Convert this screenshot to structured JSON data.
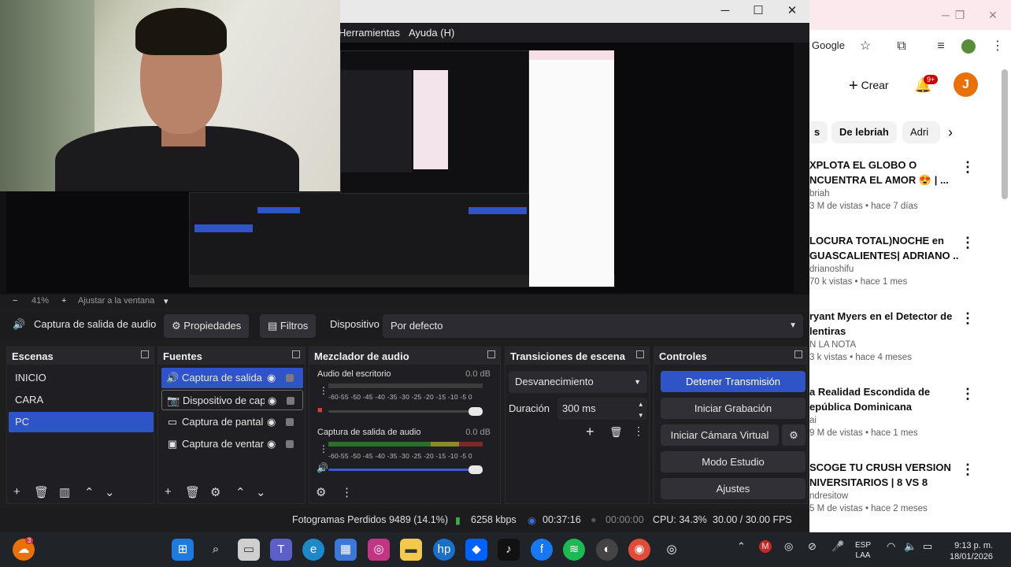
{
  "obs": {
    "menu": {
      "herramientas": "Herramientas",
      "ayuda": "Ayuda (H)"
    },
    "zoom": {
      "minus": "−",
      "value": "41%",
      "plus": "+",
      "fit": "Ajustar a la ventana"
    },
    "source_bar": {
      "selected_source": "Captura de salida de audio",
      "properties": "Propiedades",
      "filters": "Filtros",
      "device_label": "Dispositivo",
      "device_value": "Por defecto"
    },
    "scenes": {
      "title": "Escenas",
      "items": [
        "INICIO",
        "CARA",
        "PC"
      ],
      "selected": "PC"
    },
    "sources": {
      "title": "Fuentes",
      "items": [
        {
          "label": "Captura de salida",
          "icon": "speaker-icon"
        },
        {
          "label": "Dispositivo de cap",
          "icon": "camera-icon"
        },
        {
          "label": "Captura de pantal",
          "icon": "monitor-icon"
        },
        {
          "label": "Captura de ventar",
          "icon": "window-icon"
        }
      ]
    },
    "mixer": {
      "title": "Mezclador de audio",
      "channels": [
        {
          "name": "Audio del escritorio",
          "db": "0.0 dB",
          "ticks": "-60-55 -50 -45 -40 -35 -30 -25 -20 -15 -10 -5 0"
        },
        {
          "name": "Captura de salida de audio",
          "db": "0.0 dB",
          "ticks": "-60-55 -50 -45 -40 -35 -30 -25 -20 -15 -10 -5 0"
        }
      ]
    },
    "transitions": {
      "title": "Transiciones de escena",
      "type": "Desvanecimiento",
      "duration_label": "Duración",
      "duration_value": "300 ms"
    },
    "controls": {
      "title": "Controles",
      "stop_stream": "Detener Transmisión",
      "start_recording": "Iniciar Grabación",
      "virtual_cam": "Iniciar Cámara Virtual",
      "studio_mode": "Modo Estudio",
      "settings": "Ajustes"
    },
    "status": {
      "dropped_frames": "Fotogramas Perdidos 9489 (14.1%)",
      "bitrate": "6258 kbps",
      "live_time": "00:37:16",
      "rec_time": "00:00:00",
      "cpu": "CPU: 34.3%",
      "fps": "30.00 / 30.00 FPS"
    }
  },
  "chrome": {
    "google_label": "Google",
    "create": "Crear",
    "notif_count": "9+",
    "avatar_letter": "J",
    "chips": [
      "s",
      "De lebriah",
      "Adri"
    ],
    "videos": [
      {
        "title1": "XPLOTA EL GLOBO O",
        "title2": "NCUENTRA EL AMOR 😍 | ...",
        "channel": "briah",
        "meta": "3 M de vistas • hace 7 días"
      },
      {
        "title1": "LOCURA TOTAL)NOCHE en",
        "title2": "GUASCALIENTES| ADRIANO ...",
        "channel": "drianoshifu",
        "meta": "70 k vistas • hace 1 mes"
      },
      {
        "title1": "ryant Myers en el Detector de",
        "title2": "lentiras",
        "channel": "N LA NOTA",
        "meta": "3 k vistas • hace 4 meses"
      },
      {
        "title1": "a Realidad Escondida de",
        "title2": "epública Dominicana",
        "channel": "ai",
        "meta": "9 M de vistas • hace 1 mes"
      },
      {
        "title1": "SCOGE TU CRUSH VERSION",
        "title2": "NIVERSITARIOS | 8 VS 8",
        "channel": "ndresitow",
        "meta": "5 M de vistas • hace 2 meses"
      }
    ]
  },
  "taskbar": {
    "start_badge": "3",
    "lang1": "ESP",
    "lang2": "LAA",
    "time": "9:13 p. m.",
    "date": "18/01/2026"
  },
  "colors": {
    "accent": "#2f54c8",
    "obs_bg": "#1f1f23",
    "taskbar": "#202328",
    "yt_red": "#cc0000",
    "avatar_orange": "#e8710a"
  }
}
